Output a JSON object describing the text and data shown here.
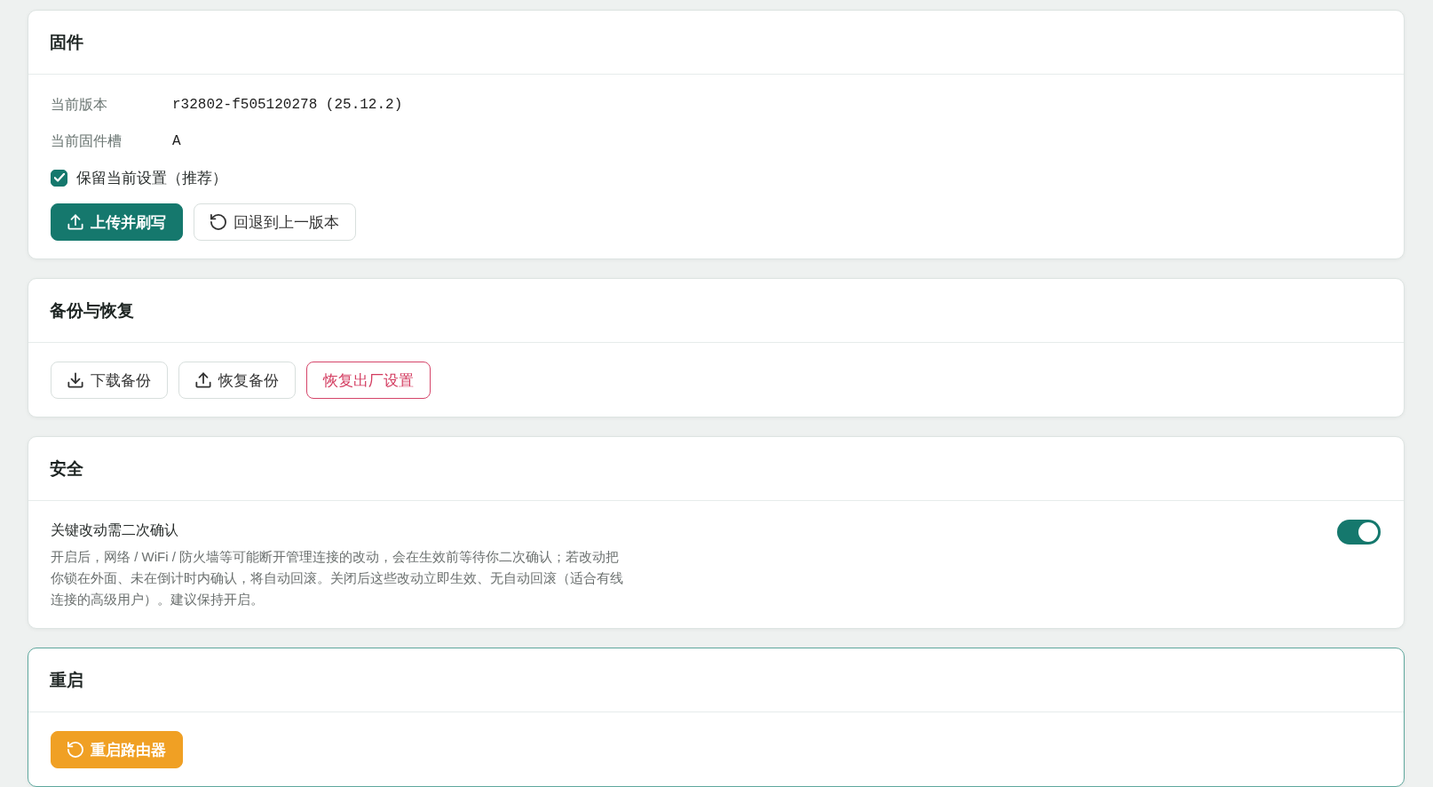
{
  "sections": [
    {
      "title": "固件",
      "highlighted": false,
      "fields": [
        {
          "label": "当前版本",
          "value": "r32802-f505120278 (25.12.2)"
        },
        {
          "label": "当前固件槽",
          "value": "A"
        }
      ],
      "checkbox": {
        "label": "保留当前设置（推荐）",
        "checked": true
      },
      "buttons": [
        {
          "label": "上传并刷写",
          "kind": "upload"
        },
        {
          "label": "回退到上一版本",
          "kind": "rollback"
        }
      ]
    },
    {
      "title": "备份与恢复",
      "highlighted": false,
      "buttons": [
        {
          "label": "下载备份",
          "kind": "download"
        },
        {
          "label": "恢复备份",
          "kind": "restore"
        },
        {
          "label": "恢复出厂设置",
          "kind": "factory_reset"
        }
      ]
    },
    {
      "title": "安全",
      "highlighted": false,
      "setting": {
        "label": "关键改动需二次确认",
        "description": "开启后，网络 / WiFi / 防火墙等可能断开管理连接的改动，会在生效前等待你二次确认；若改动把你锁在外面、未在倒计时内确认，将自动回滚。关闭后这些改动立即生效、无自动回滚（适合有线连接的高级用户）。建议保持开启。",
        "on": true
      }
    },
    {
      "title": "重启",
      "highlighted": true,
      "buttons": [
        {
          "label": "重启路由器",
          "kind": "reboot"
        }
      ]
    }
  ]
}
